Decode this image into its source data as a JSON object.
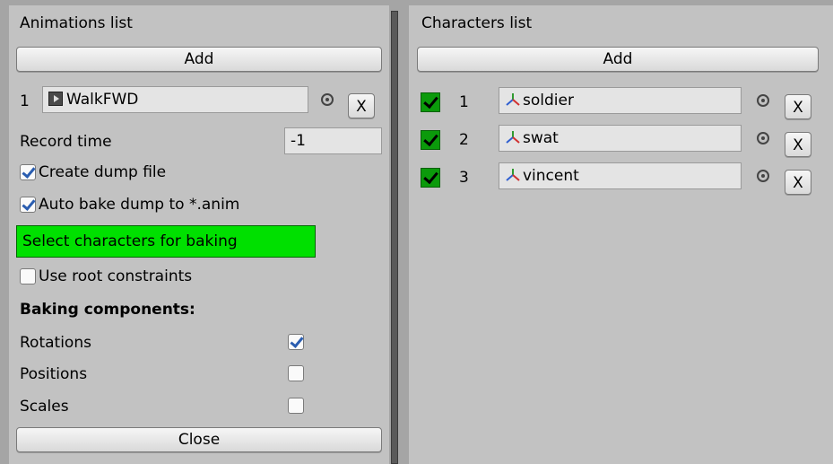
{
  "left_panel": {
    "title": "Animations list",
    "add_label": "Add",
    "animation": {
      "index": "1",
      "name": "WalkFWD",
      "remove_label": "X"
    },
    "record_time_label": "Record time",
    "record_time_value": "-1",
    "create_dump_label": "Create dump file",
    "create_dump_checked": true,
    "auto_bake_label": "Auto bake dump to *.anim",
    "auto_bake_checked": true,
    "select_banner": "Select characters for baking",
    "root_constraints_label": "Use root constraints",
    "root_constraints_checked": false,
    "components_heading": "Baking components:",
    "components": [
      {
        "label": "Rotations",
        "checked": true
      },
      {
        "label": "Positions",
        "checked": false
      },
      {
        "label": "Scales",
        "checked": false
      }
    ],
    "close_label": "Close"
  },
  "right_panel": {
    "title": "Characters list",
    "add_label": "Add",
    "characters": [
      {
        "index": "1",
        "name": "soldier",
        "remove_label": "X"
      },
      {
        "index": "2",
        "name": "swat",
        "remove_label": "X"
      },
      {
        "index": "3",
        "name": "vincent",
        "remove_label": "X"
      }
    ]
  },
  "colors": {
    "panel": "#c2c2c2",
    "banner_green": "#00e000",
    "check_green": "#0b9a0b"
  }
}
